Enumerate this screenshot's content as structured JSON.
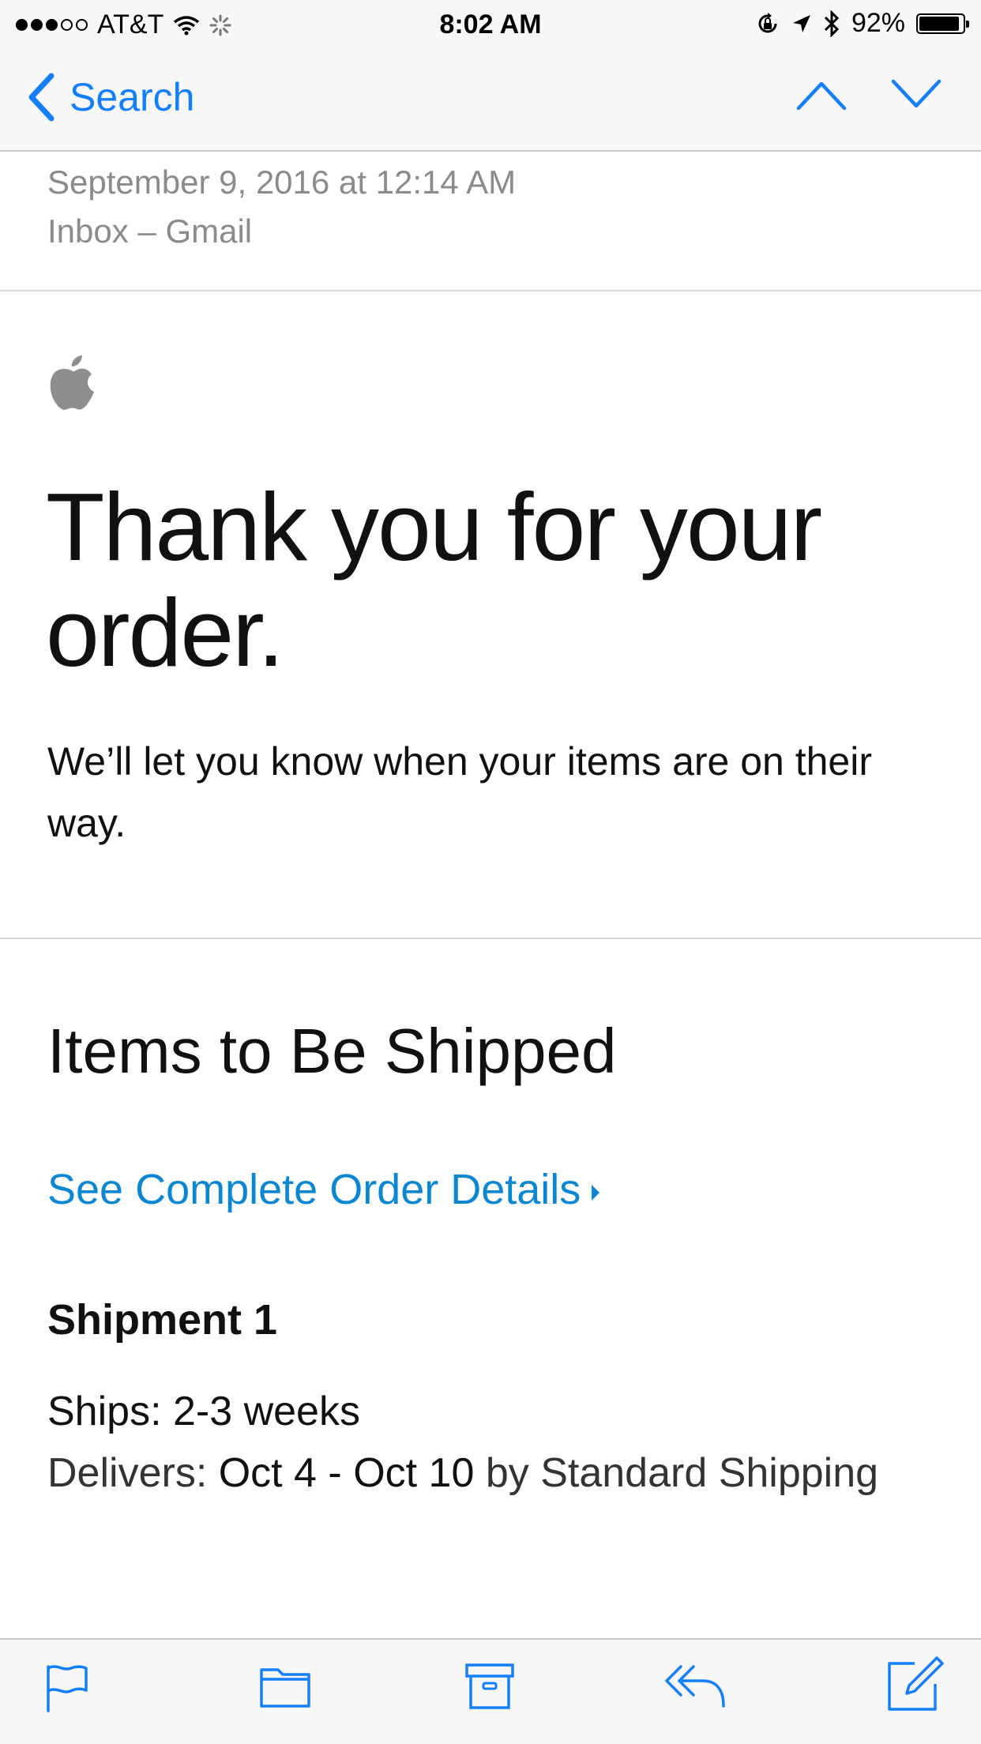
{
  "status_bar": {
    "carrier": "AT&T",
    "time": "8:02 AM",
    "battery": "92%",
    "battery_level": 0.92,
    "signal_bars_filled": 3,
    "signal_bars_total": 5
  },
  "nav": {
    "back_label": "Search",
    "icons": [
      "chevron-left-icon",
      "chevron-up-icon",
      "chevron-down-icon"
    ]
  },
  "message": {
    "date": "September 9, 2016 at 12:14 AM",
    "mailbox": "Inbox – Gmail"
  },
  "email": {
    "hero_title": "Thank you for your order.",
    "hero_subtitle": "We’ll let you know when your items are on their way.",
    "section_title": "Items to Be Shipped",
    "order_link": "See Complete Order Details",
    "shipment_title": "Shipment 1",
    "ships_label": "Ships:",
    "ships_value": "2-3 weeks",
    "delivers_label": "Delivers:",
    "delivers_value": "Oct 4 - Oct 10",
    "delivers_method": "by Standard Shipping"
  },
  "toolbar": {
    "icons": [
      "flag-icon",
      "folder-icon",
      "archive-icon",
      "reply-icon",
      "compose-icon"
    ]
  },
  "colors": {
    "accent": "#157efb",
    "link": "#0b86d1",
    "meta_gray": "#8a8a8f",
    "apple_logo": "#8e8e8e"
  }
}
